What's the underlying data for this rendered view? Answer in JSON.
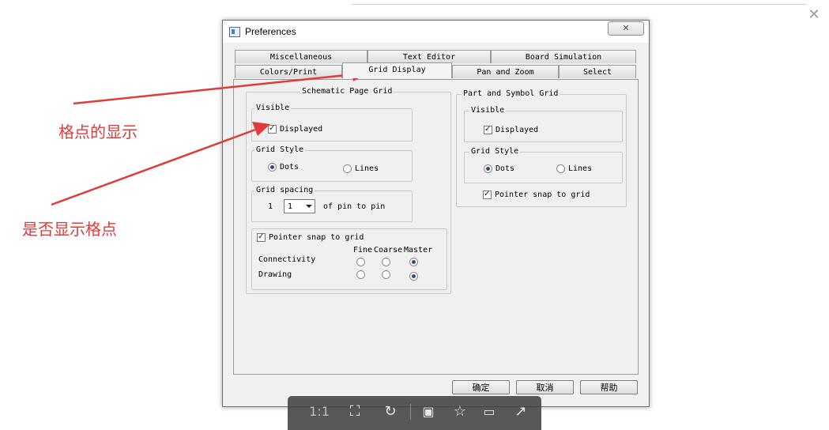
{
  "window": {
    "title": "Preferences"
  },
  "tabs_row1": [
    "Miscellaneous",
    "Text Editor",
    "Board Simulation"
  ],
  "tabs_row2": [
    "Colors/Print",
    "Grid Display",
    "Pan and Zoom",
    "Select"
  ],
  "active_tab": "Grid Display",
  "schematic": {
    "title": "Schematic Page Grid",
    "visible_title": "Visible",
    "displayed_label": "Displayed",
    "style_title": "Grid Style",
    "dots_label": "Dots",
    "lines_label": "Lines",
    "spacing_title": "Grid spacing",
    "spacing_prefix": "1",
    "spacing_value": "1",
    "spacing_suffix": "of pin to pin",
    "snap_label": "Pointer snap to grid",
    "col_fine": "Fine",
    "col_coarse": "Coarse",
    "col_master": "Master",
    "row_connectivity": "Connectivity",
    "row_drawing": "Drawing"
  },
  "part": {
    "title": "Part and Symbol Grid",
    "visible_title": "Visible",
    "displayed_label": "Displayed",
    "style_title": "Grid Style",
    "dots_label": "Dots",
    "lines_label": "Lines",
    "snap_label": "Pointer snap to grid"
  },
  "buttons": {
    "ok": "确定",
    "cancel": "取消",
    "help": "帮助"
  },
  "annotations": {
    "grid_display": "格点的显示",
    "show_grid": "是否显示格点"
  },
  "viewer_toolbar": {
    "actual_size": "1:1"
  },
  "colors": {
    "annotation": "#e03b3b",
    "toolbar_bg": "#414141"
  }
}
